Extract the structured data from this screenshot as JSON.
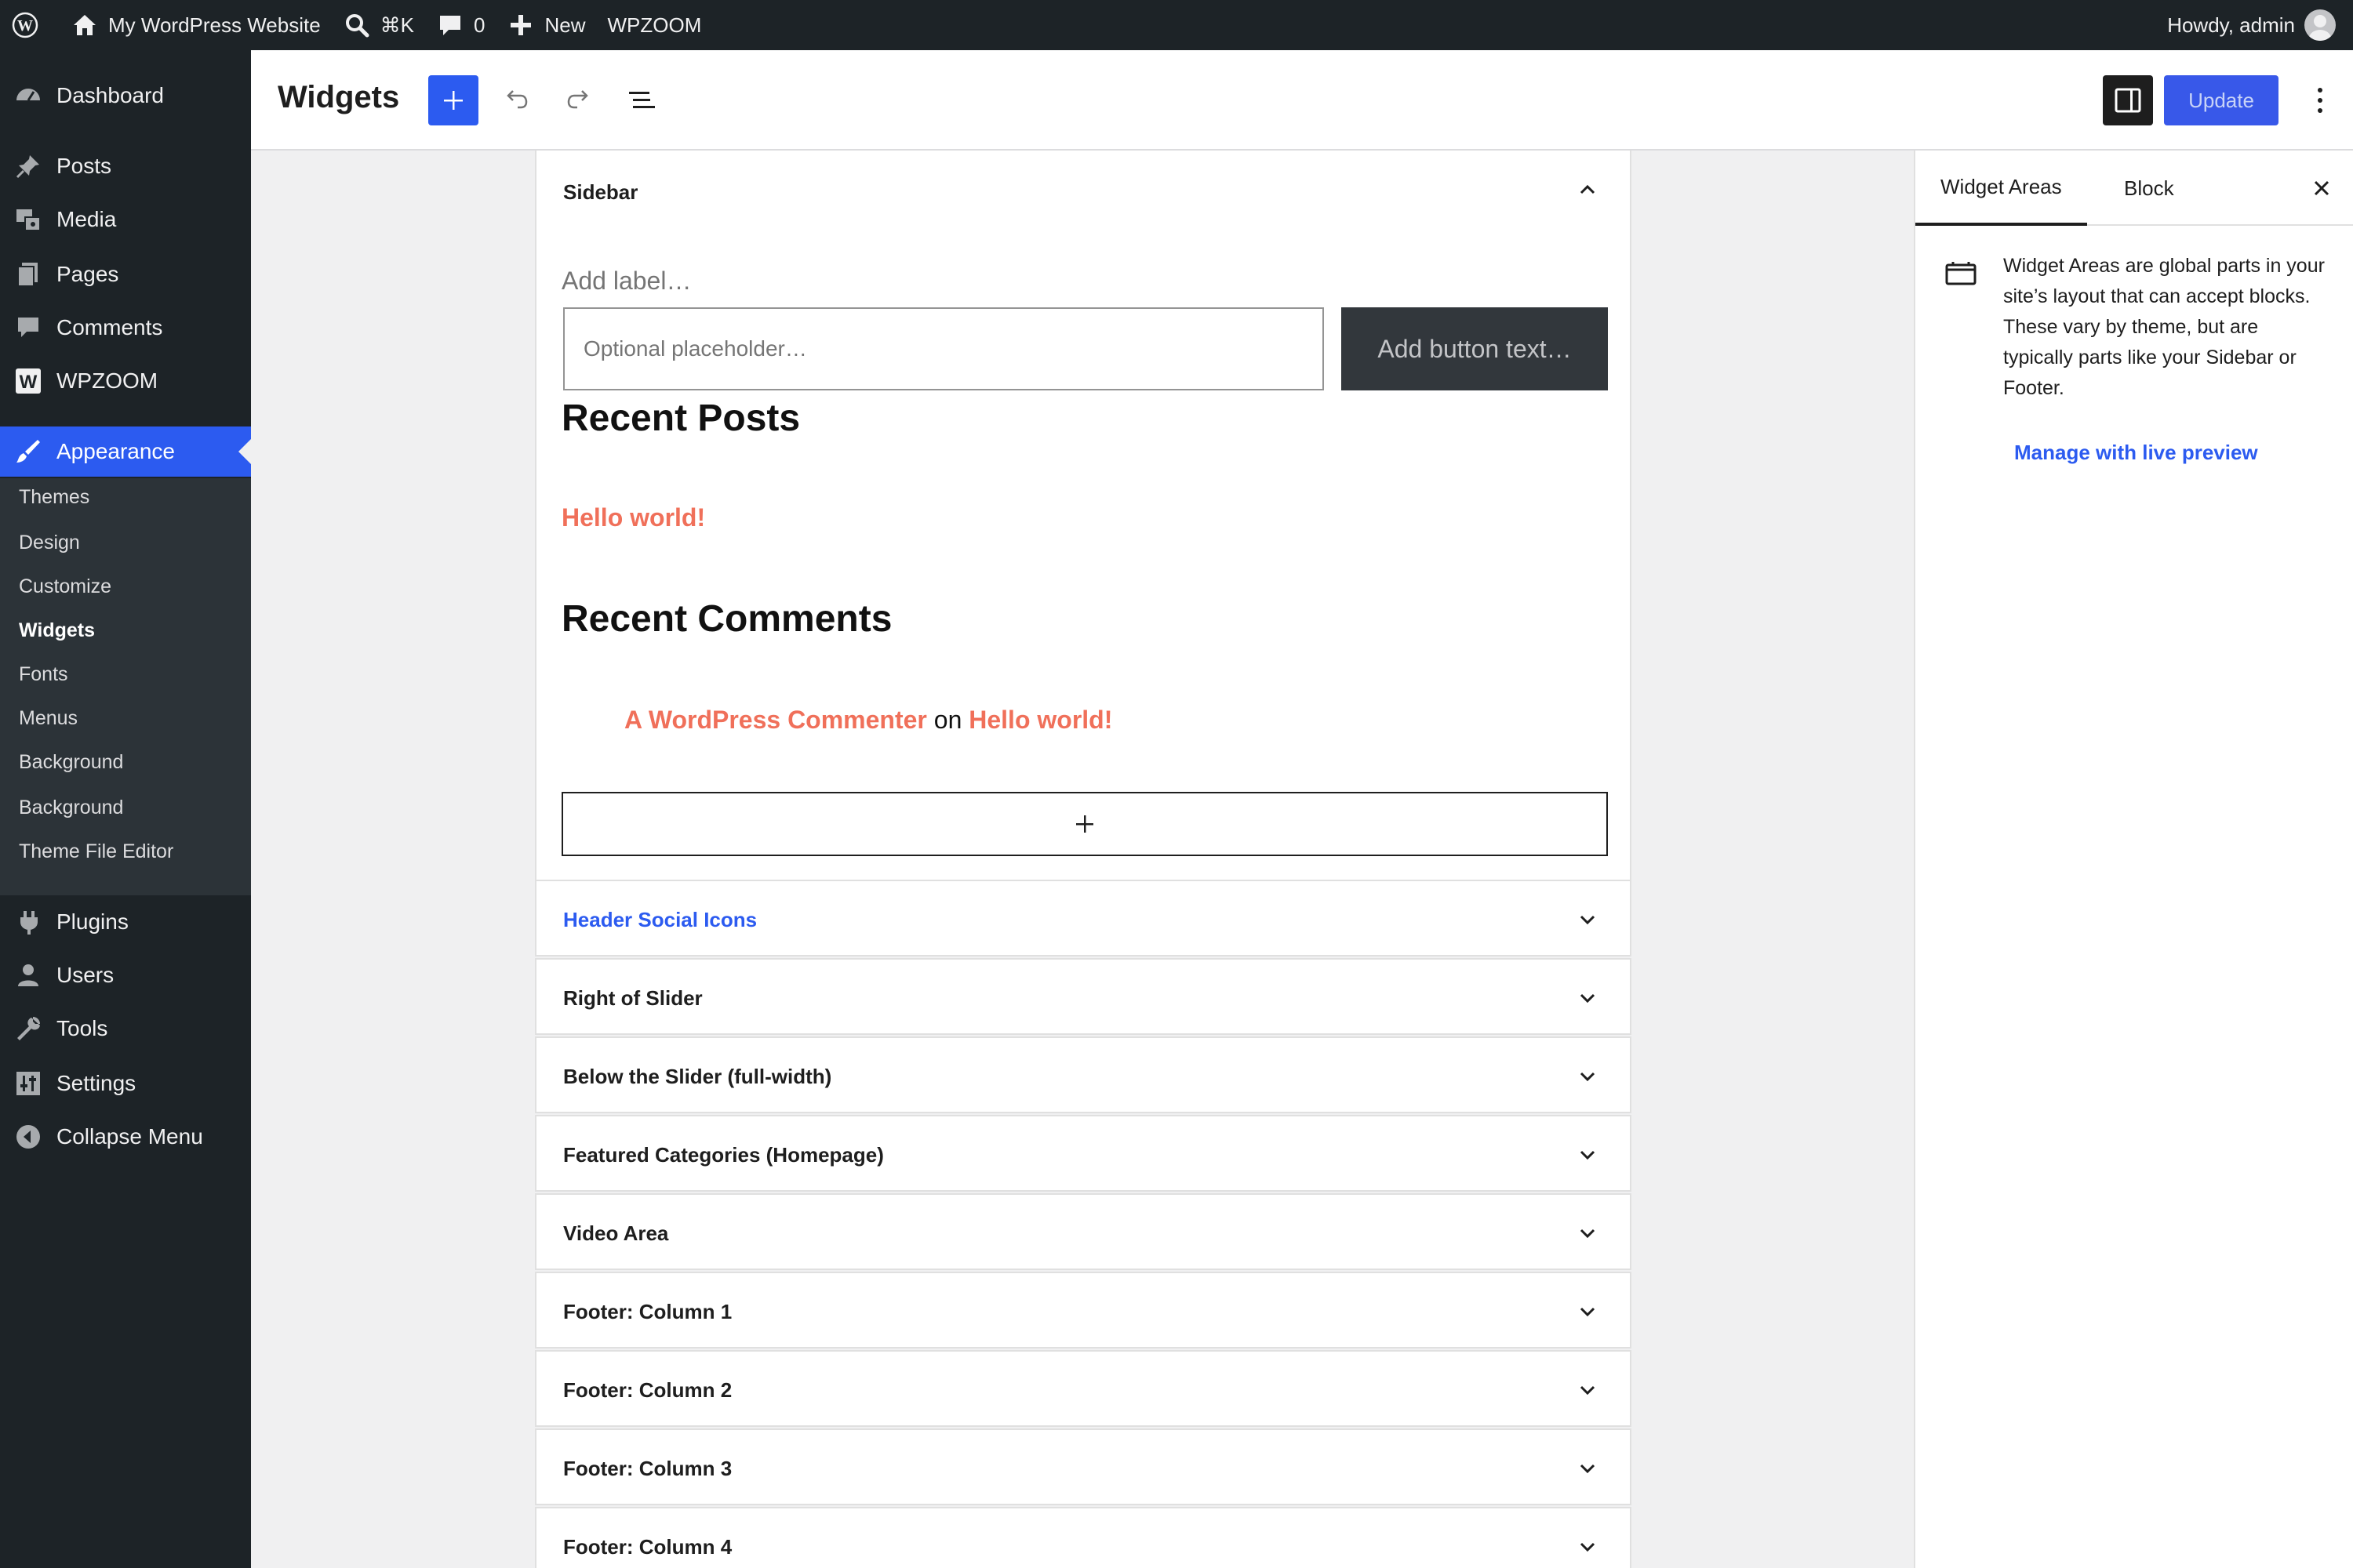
{
  "admin_bar": {
    "site_name": "My WordPress Website",
    "search_shortcut": "⌘K",
    "comments_count": "0",
    "new_label": "New",
    "plugin_label": "WPZOOM",
    "greeting": "Howdy, admin"
  },
  "menu": {
    "dashboard": "Dashboard",
    "posts": "Posts",
    "media": "Media",
    "pages": "Pages",
    "comments": "Comments",
    "wpzoom": "WPZOOM",
    "appearance": "Appearance",
    "submenu": [
      "Themes",
      "Design",
      "Customize",
      "Widgets",
      "Fonts",
      "Menus",
      "Background",
      "Background",
      "Theme File Editor"
    ],
    "plugins": "Plugins",
    "users": "Users",
    "tools": "Tools",
    "settings": "Settings",
    "collapse": "Collapse Menu"
  },
  "header": {
    "title": "Widgets",
    "update_label": "Update"
  },
  "sidebar_area": {
    "title": "Sidebar",
    "search_label_placeholder": "Add label…",
    "search_input_placeholder": "Optional placeholder…",
    "search_button_placeholder": "Add button text…",
    "recent_posts_heading": "Recent Posts",
    "recent_post_link": "Hello world!",
    "recent_comments_heading": "Recent Comments",
    "comment_author": "A WordPress Commenter",
    "comment_on": "on",
    "comment_post": "Hello world!"
  },
  "widget_areas": [
    "Header Social Icons",
    "Right of Slider",
    "Below the Slider (full-width)",
    "Featured Categories (Homepage)",
    "Video Area",
    "Footer: Column 1",
    "Footer: Column 2",
    "Footer: Column 3",
    "Footer: Column 4"
  ],
  "inspector": {
    "tab_widget_areas": "Widget Areas",
    "tab_block": "Block",
    "description": "Widget Areas are global parts in your site’s layout that can accept blocks. These vary by theme, but are typically parts like your Sidebar or Footer.",
    "live_preview_link": "Manage with live preview"
  },
  "colors": {
    "admin_dark": "#1d2327",
    "accent_blue": "#2c5bf0",
    "link_orange": "#f0705a"
  }
}
